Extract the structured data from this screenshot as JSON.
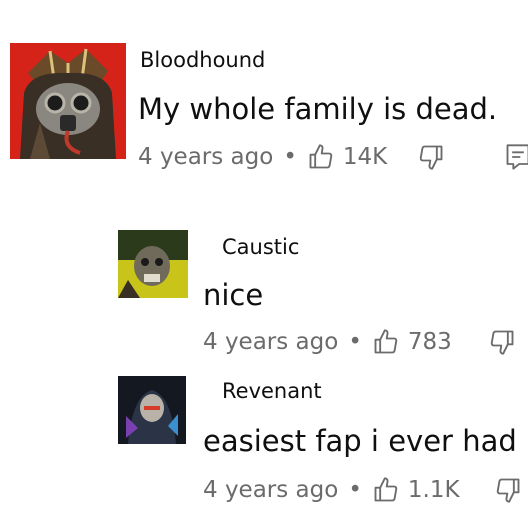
{
  "comments": [
    {
      "author": "Bloodhound",
      "text": "My whole family is dead.",
      "time": "4 years ago",
      "separator": "•",
      "likes": "14K",
      "avatar": "bloodhound-avatar",
      "avatar_bg": "#d6231a"
    }
  ],
  "replies": [
    {
      "author": "Caustic",
      "text": "nice",
      "time": "4 years ago",
      "separator": "•",
      "likes": "783",
      "avatar": "caustic-avatar",
      "avatar_bg": "#c8c41a"
    },
    {
      "author": "Revenant",
      "text": "easiest fap i ever had",
      "time": "4 years ago",
      "separator": "•",
      "likes": "1.1K",
      "avatar": "revenant-avatar",
      "avatar_bg": "#141820"
    }
  ],
  "icons": {
    "like": "thumbs-up-icon",
    "dislike": "thumbs-down-icon",
    "reply": "reply-icon"
  },
  "colors": {
    "text": "#0f0f0f",
    "meta": "#6b6b6b",
    "background": "#ffffff"
  }
}
